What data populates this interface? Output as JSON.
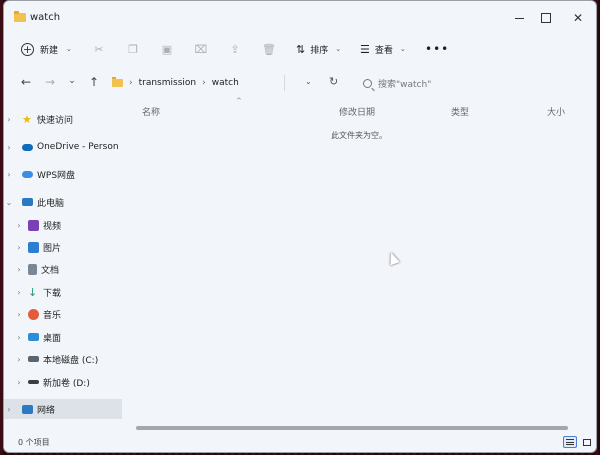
{
  "window": {
    "title": "watch",
    "minimize_glyph": "",
    "maximize_glyph": "",
    "close_glyph": "✕"
  },
  "toolbar": {
    "new_label": "新建",
    "sort_label": "排序",
    "view_label": "查看",
    "more_glyph": "•••"
  },
  "nav": {
    "back_glyph": "←",
    "forward_glyph": "→",
    "recent_glyph": "⌄",
    "up_glyph": "↑",
    "breadcrumb": [
      "transmission",
      "watch"
    ],
    "breadcrumb_lead_glyph": "›",
    "breadcrumb_sep_glyph": "›",
    "refresh_glyph": "↻",
    "dropdown_glyph": "⌄"
  },
  "search": {
    "placeholder": "搜索\"watch\""
  },
  "sidebar": {
    "items": [
      {
        "label": "快速访问",
        "icon": "star-icon",
        "color": "#f2b705"
      },
      {
        "label": "OneDrive - Person",
        "icon": "onedrive-cloud-icon",
        "color": "#0f6cbd"
      },
      {
        "label": "WPS网盘",
        "icon": "wps-cloud-icon",
        "color": "#3a8ee6"
      },
      {
        "label": "此电脑",
        "icon": "computer-icon",
        "color": "#2b79c2"
      },
      {
        "label": "视频",
        "icon": "video-icon",
        "color": "#7b3fb8"
      },
      {
        "label": "图片",
        "icon": "pictures-icon",
        "color": "#2d7dd2"
      },
      {
        "label": "文档",
        "icon": "documents-icon",
        "color": "#7a8797"
      },
      {
        "label": "下载",
        "icon": "download-icon",
        "color": "#1b9e6b"
      },
      {
        "label": "音乐",
        "icon": "music-icon",
        "color": "#e25c3b"
      },
      {
        "label": "桌面",
        "icon": "desktop-icon",
        "color": "#2a8fd6"
      },
      {
        "label": "本地磁盘 (C:)",
        "icon": "local-disk-icon",
        "color": "#5b6570"
      },
      {
        "label": "新加卷 (D:)",
        "icon": "drive-icon",
        "color": "#3b3f45"
      },
      {
        "label": "网络",
        "icon": "network-icon",
        "color": "#2b79c2"
      }
    ],
    "caret_glyph": "›"
  },
  "columns": {
    "name": "名称",
    "modified": "修改日期",
    "type": "类型",
    "size": "大小",
    "sort_glyph": "^"
  },
  "content": {
    "empty_message": "此文件夹为空。"
  },
  "status": {
    "item_count": "0 个项目"
  }
}
